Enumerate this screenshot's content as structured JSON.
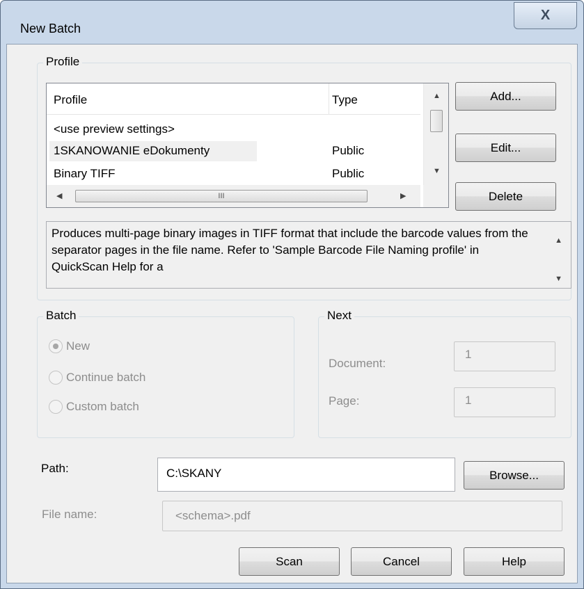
{
  "window": {
    "title": "New Batch",
    "close_glyph": "X"
  },
  "profile_group": {
    "label": "Profile",
    "columns": [
      "Profile",
      "Type"
    ],
    "rows": [
      {
        "name": "<use preview settings>",
        "type": ""
      },
      {
        "name": "1SKANOWANIE eDokumenty",
        "type": "Public"
      },
      {
        "name": "Binary TIFF",
        "type": "Public"
      }
    ],
    "hscroll_grip": "III",
    "buttons": {
      "add": "Add...",
      "edit": "Edit...",
      "delete": "Delete"
    },
    "description": "Produces multi-page binary images in TIFF format that include the barcode values from the separator pages in the file name. Refer to 'Sample Barcode File Naming profile' in QuickScan Help for a"
  },
  "batch_group": {
    "label": "Batch",
    "options": [
      {
        "label": "New",
        "checked": true
      },
      {
        "label": "Continue batch",
        "checked": false
      },
      {
        "label": "Custom batch",
        "checked": false
      }
    ]
  },
  "next_group": {
    "label": "Next",
    "document_label": "Document:",
    "document_value": "1",
    "page_label": "Page:",
    "page_value": "1"
  },
  "path": {
    "label": "Path:",
    "value": "C:\\SKANY",
    "browse": "Browse..."
  },
  "file_name": {
    "label": "File name:",
    "value": "<schema>.pdf"
  },
  "footer": {
    "scan": "Scan",
    "cancel": "Cancel",
    "help": "Help"
  },
  "icons": {
    "up": "arrow-up-icon",
    "down": "arrow-down-icon",
    "left": "arrow-left-icon",
    "right": "arrow-right-icon"
  }
}
